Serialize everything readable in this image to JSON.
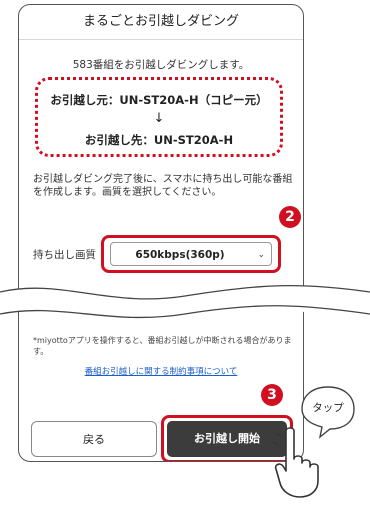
{
  "dialog": {
    "title": "まるごとお引越しダビング",
    "lead": "583番組をお引越しダビングします。",
    "source": "お引越し元：UN-ST20A-H（コピー元）",
    "arrow": "↓",
    "destination": "お引越し先：UN-ST20A-H",
    "note": "お引越しダビング完了後に、スマホに持ち出し可能な番組を作成します。画質を選択してください。",
    "quality_label": "持ち出し画質",
    "quality_value": "650kbps(360p)",
    "fine_print": "*miyottoアプリを操作すると、番組お引越しが中断される場合があります。",
    "link_text": "番組お引越しに関する制約事項について",
    "back_button": "戻る",
    "start_button": "お引越し開始"
  },
  "annotations": {
    "step2": "2",
    "step3": "3",
    "tap_label": "タップ"
  },
  "colors": {
    "highlight": "#d01020",
    "primary_button": "#3c3c3c",
    "link": "#1a5ec9"
  }
}
